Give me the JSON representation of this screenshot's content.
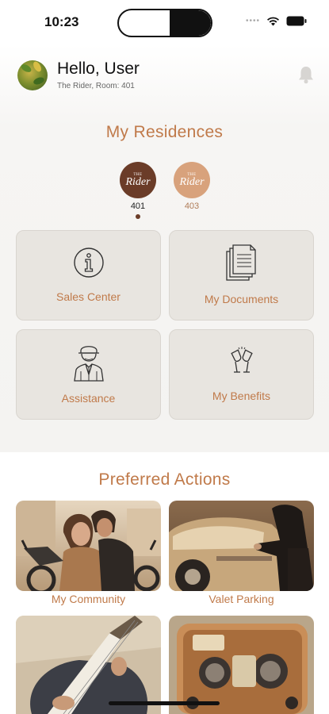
{
  "status_bar": {
    "time": "10:23",
    "icons": [
      "cellular-dots-icon",
      "wifi-icon",
      "battery-icon"
    ]
  },
  "header": {
    "greeting": "Hello, User",
    "subtitle": "The Rider, Room: 401",
    "avatar": "avatar-photo",
    "notification_icon": "bell-icon"
  },
  "residences": {
    "title": "My Residences",
    "items": [
      {
        "label": "401",
        "logo_text_top": "THE",
        "logo_text": "Rider",
        "color": "#6b3c28",
        "selected": true
      },
      {
        "label": "403",
        "logo_text_top": "THE",
        "logo_text": "Rider",
        "color": "#d8a27c",
        "selected": false
      }
    ]
  },
  "tiles": [
    {
      "label": "Sales Center",
      "icon": "info-icon"
    },
    {
      "label": "My Documents",
      "icon": "documents-icon"
    },
    {
      "label": "Assistance",
      "icon": "concierge-icon"
    },
    {
      "label": "My Benefits",
      "icon": "champagne-icon"
    }
  ],
  "preferred_actions": {
    "title": "Preferred Actions",
    "items": [
      {
        "label": "My Community",
        "image": "motorcycle-couple-image"
      },
      {
        "label": "Valet Parking",
        "image": "vintage-car-image"
      },
      {
        "label": "",
        "image": "guitar-image"
      },
      {
        "label": "",
        "image": "vintage-radio-image"
      }
    ]
  },
  "colors": {
    "accent": "#c07a4a",
    "tile_bg": "#e8e5e0",
    "residence_selected": "#6b3c28",
    "residence_other": "#d8a27c"
  }
}
